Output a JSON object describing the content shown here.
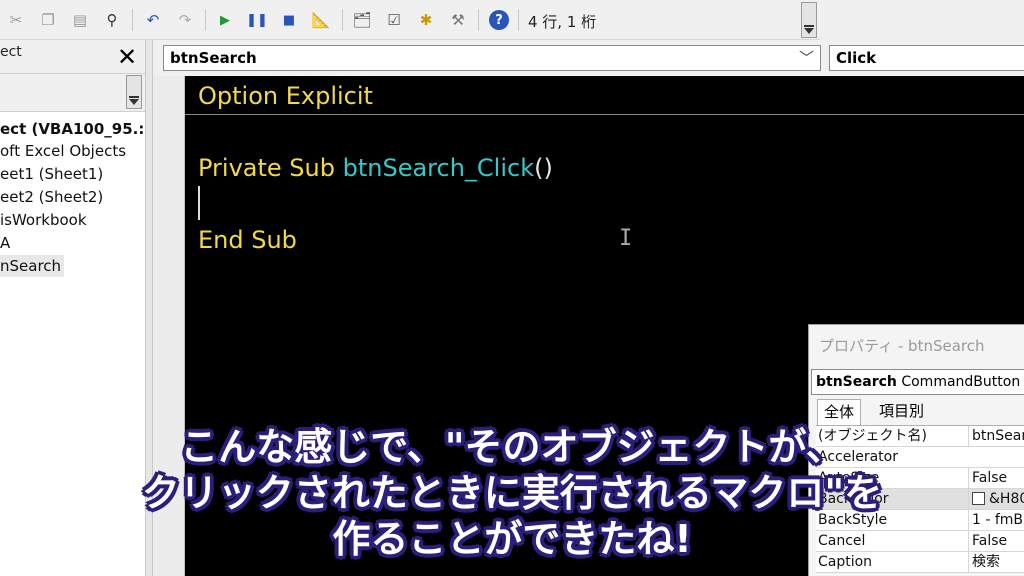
{
  "toolbar": {
    "icons": [
      "cut-icon",
      "copy-icon",
      "paste-icon",
      "find-icon",
      "undo-icon",
      "redo-icon",
      "run-icon",
      "break-icon",
      "reset-icon",
      "design-mode-icon",
      "project-explorer-icon",
      "properties-window-icon",
      "object-browser-icon",
      "toolbox-icon",
      "help-icon"
    ],
    "status": "4 行, 1 桁"
  },
  "project": {
    "title": "ect",
    "close_label": "✕",
    "items": [
      {
        "label": "ect (VBA100_95.:",
        "bold": true
      },
      {
        "label": "oft Excel Objects",
        "bold": false
      },
      {
        "label": "eet1 (Sheet1)",
        "bold": false
      },
      {
        "label": "eet2 (Sheet2)",
        "bold": false
      },
      {
        "label": "isWorkbook",
        "bold": false
      },
      {
        "label": "A",
        "bold": false
      },
      {
        "label": "nSearch",
        "bold": false,
        "selected": true
      }
    ]
  },
  "code": {
    "object_combo": "btnSearch",
    "procedure_combo": "Click",
    "lines": {
      "option": "Option Explicit",
      "sub_keyword": "Private Sub ",
      "sub_name": "btnSearch_Click",
      "sub_paren": "()",
      "end": "End Sub"
    },
    "colors": {
      "keyword": "#f2d84b",
      "identifier": "#35c9c9",
      "background": "#000000"
    }
  },
  "properties": {
    "title": "プロパティ - btnSearch",
    "object_name": "btnSearch",
    "object_type": " CommandButton",
    "tabs": [
      "全体",
      "項目別"
    ],
    "rows": [
      {
        "name": "(オブジェクト名)",
        "value": "btnSearch"
      },
      {
        "name": "Accelerator",
        "value": ""
      },
      {
        "name": "AutoSize",
        "value": "False"
      },
      {
        "name": "BackColor",
        "value": "&H80"
      },
      {
        "name": "BackStyle",
        "value": "1 - fmB"
      },
      {
        "name": "Cancel",
        "value": "False"
      },
      {
        "name": "Caption",
        "value": "検索"
      }
    ]
  },
  "subtitle": {
    "line1": "こんな感じで、\"そのオブジェクトが、",
    "line2": "クリックされたときに実行されるマクロ\"を",
    "line3": "作ることができたね!"
  }
}
